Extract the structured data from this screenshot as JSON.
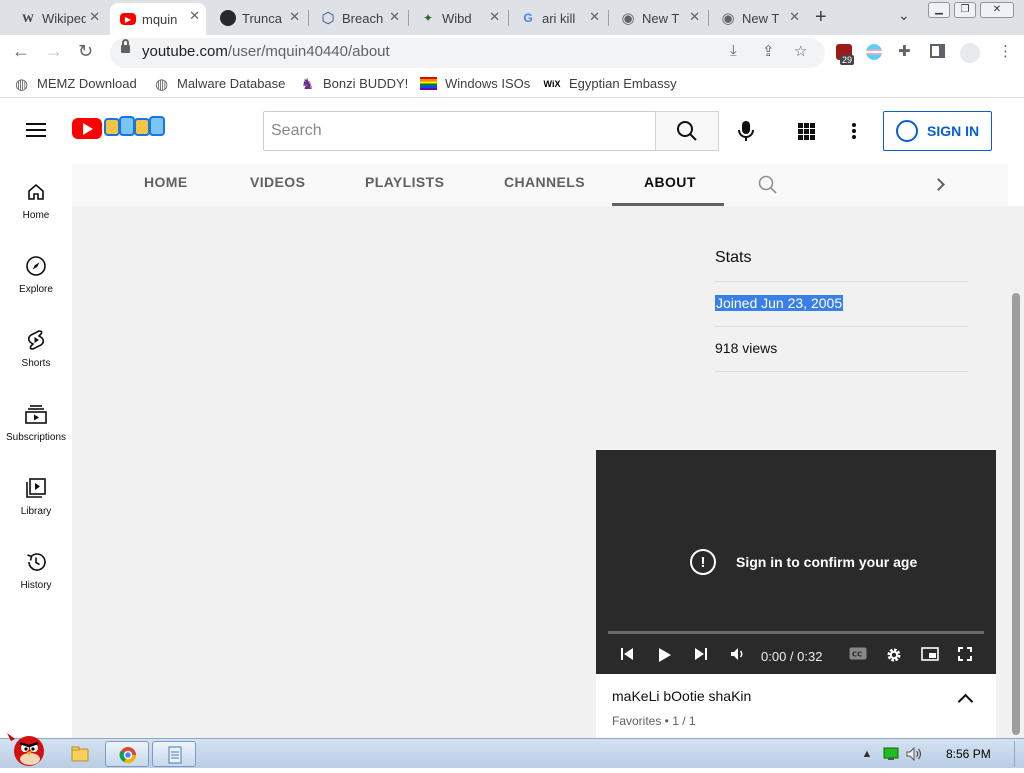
{
  "browser": {
    "tabs": [
      {
        "title": "Wikipedia",
        "favicon": "wikipedia-icon",
        "glyph": "W"
      },
      {
        "title": "mquin",
        "favicon": "youtube-icon",
        "glyph": "▶",
        "active": true
      },
      {
        "title": "Trunca",
        "favicon": "github-icon",
        "glyph": "●"
      },
      {
        "title": "Breach",
        "favicon": "breach-icon",
        "glyph": "⬡"
      },
      {
        "title": "Wibd",
        "favicon": "site-icon",
        "glyph": "✦"
      },
      {
        "title": "ari kill",
        "favicon": "google-icon",
        "glyph": "G"
      },
      {
        "title": "New T",
        "favicon": "chrome-icon",
        "glyph": "◉"
      },
      {
        "title": "New T",
        "favicon": "chrome-icon",
        "glyph": "◉"
      }
    ],
    "new_tab": "+",
    "tab_dropdown": "⌄",
    "url_host": "youtube.com",
    "url_path": "/user/mquin40440/about",
    "extension_badge": "29"
  },
  "bookmarks": [
    {
      "label": "MEMZ Download",
      "icon": "globe-icon",
      "glyph": "◍"
    },
    {
      "label": "Malware Database",
      "icon": "globe-icon",
      "glyph": "◍"
    },
    {
      "label": "Bonzi BUDDY!",
      "icon": "bonzi-icon",
      "glyph": "♞"
    },
    {
      "label": "Windows ISOs",
      "icon": "rainbow-flag-icon",
      "glyph": ""
    },
    {
      "label": "Egyptian Embassy",
      "icon": "wix-icon",
      "glyph": "WiX"
    }
  ],
  "youtube": {
    "search_placeholder": "Search",
    "sign_in": "SIGN IN",
    "guide": [
      {
        "label": "Home",
        "icon": "home-icon"
      },
      {
        "label": "Explore",
        "icon": "compass-icon"
      },
      {
        "label": "Shorts",
        "icon": "shorts-icon"
      },
      {
        "label": "Subscriptions",
        "icon": "subscriptions-icon"
      },
      {
        "label": "Library",
        "icon": "library-icon"
      },
      {
        "label": "History",
        "icon": "history-icon"
      }
    ],
    "channel_tabs": [
      "HOME",
      "VIDEOS",
      "PLAYLISTS",
      "CHANNELS",
      "ABOUT"
    ],
    "active_tab": "ABOUT",
    "stats": {
      "title": "Stats",
      "joined": "Joined Jun 23, 2005",
      "views": "918 views"
    },
    "miniplayer": {
      "message": "Sign in to confirm your age",
      "time": "0:00 / 0:32",
      "title": "maKeLi bOotie shaKin",
      "subtitle": "Favorites • 1 / 1"
    }
  },
  "taskbar": {
    "clock": "8:56 PM"
  }
}
